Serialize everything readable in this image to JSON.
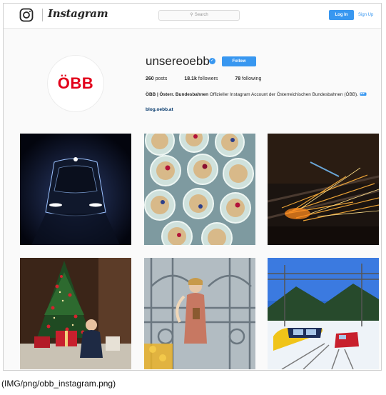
{
  "header": {
    "brand": "Instagram",
    "search_placeholder": "Search",
    "login_label": "Log In",
    "signup_label": "Sign Up",
    "accent_color": "#3897f0"
  },
  "profile": {
    "avatar_text": "ÖBB",
    "avatar_color": "#e2001a",
    "username": "unsereoebb",
    "verified": true,
    "follow_label": "Follow",
    "posts": "260",
    "posts_label": "posts",
    "followers": "18.1k",
    "followers_label": "followers",
    "following": "78",
    "following_label": "following",
    "bio_name": "ÖBB | Österr. Bundesbahnen",
    "bio_text": "Offizieller Instagram Account der Österreichischen Bundesbahnen (ÖBB).",
    "link": "blog.oebb.at"
  },
  "posts": [
    {
      "subject": "train front at night"
    },
    {
      "subject": "muesli glasses with berries"
    },
    {
      "subject": "sparks from welding on track"
    },
    {
      "subject": "child with christmas tree and gifts"
    },
    {
      "subject": "angel figure behind iron gate"
    },
    {
      "subject": "trains in snowy landscape"
    }
  ],
  "caption": "(IMG/png/obb_instagram.png)"
}
